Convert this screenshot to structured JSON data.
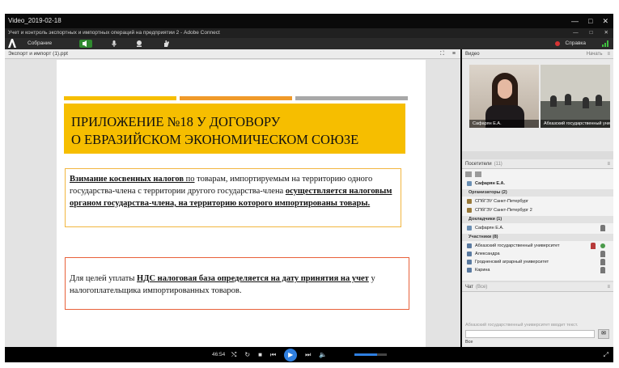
{
  "video_window": {
    "title": "Video_2019-02-18",
    "controls": [
      "—",
      "□",
      "✕"
    ]
  },
  "app_window": {
    "title": "Учет и контроль экспортных и импортных операций на предприятии 2 - Adobe Connect",
    "controls": [
      "—",
      "□",
      "✕"
    ]
  },
  "toolbar": {
    "logo": "Adobe",
    "meeting_label": "Собрание",
    "help_label": "Справка"
  },
  "share_pod": {
    "title": "Экспорт и импорт (1).ppt"
  },
  "slide": {
    "strip_colors": [
      "#f6be00",
      "#f09a2a",
      "#a8a8a8"
    ],
    "title_line1": "ПРИЛОЖЕНИЕ №18 У ДОГОВОРУ",
    "title_line2": "О ЕВРАЗИЙСКОМ ЭКОНОМИЧЕСКОМ СОЮЗЕ",
    "box1": {
      "bold_lead": "Взимание косвенных налогов",
      "underlined_part": " по",
      "text_mid": " товарам, импортируемым на территорию одного государства-члена с территории другого государства-члена ",
      "bold_end": "осуществляется налоговым органом государства-члена, на территорию которого импортированы товары."
    },
    "box2": {
      "text_lead": "Для целей уплаты ",
      "bold_mid": "НДС налоговая база определяется на дату принятия на учет",
      "text_end": " у налогоплательщика импортированных товаров."
    }
  },
  "video_pod": {
    "title": "Видео",
    "count": "(2)",
    "start_label": "Начать",
    "tiles": [
      {
        "label": "Сафарян Е.А."
      },
      {
        "label": "Абхазский государственный университет"
      }
    ]
  },
  "attendees_pod": {
    "title": "Посетители",
    "count": "(11)",
    "current_user": "Сафарян Е.А.",
    "groups": [
      {
        "label": "Организаторы (2)",
        "members": [
          "СПбГЭУ Санкт-Петербург",
          "СПбГЭУ Санкт-Петербург 2"
        ]
      },
      {
        "label": "Докладчики (1)",
        "members": [
          "Сафарян Е.А."
        ]
      },
      {
        "label": "Участники (8)",
        "members": [
          "Абхазский государственный университет",
          "Александра",
          "Гродненский аграрный университет",
          "Карина"
        ]
      }
    ]
  },
  "chat_pod": {
    "title": "Чат",
    "count": "(Все)",
    "typing_hint": "Абхазский государственный университет вводит текст.",
    "recipient": "Все"
  },
  "player": {
    "time": "46:54",
    "volume_fraction": 0.7
  },
  "colors": {
    "slide_title_bg": "#f6be00",
    "box1_border": "#f2b640",
    "box2_border": "#e8613a",
    "accent": "#2f7fe0"
  }
}
